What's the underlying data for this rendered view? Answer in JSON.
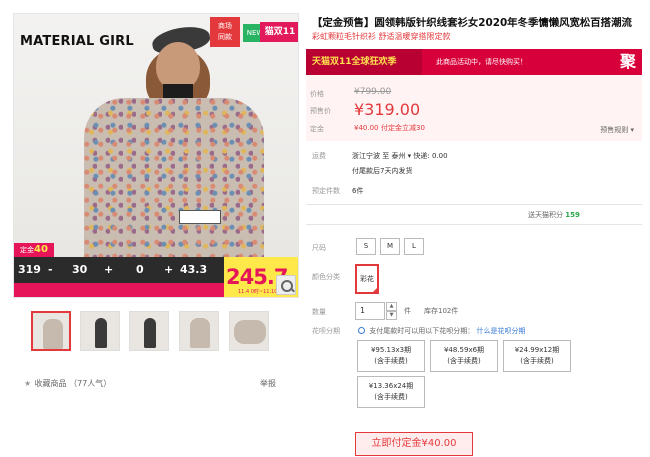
{
  "gallery": {
    "brand": "MATERIAL GIRL",
    "tag_mall": "商场\n同款",
    "tag_new": "NEW",
    "tag_double11": "猫双11",
    "banner": {
      "deposit_label": "定金",
      "deposit_value": "40",
      "price1": "319",
      "op1": "-",
      "val1": "30",
      "op2": "+",
      "val2": "0",
      "op3": "+",
      "val3": "43.3",
      "final_price": "245.7",
      "date": "11.4 0时~11.10 24"
    },
    "thumbnails": 5,
    "favorite_label": "收藏商品",
    "favorite_count": "（77人气）",
    "report_label": "举报"
  },
  "product": {
    "title": "【定金预售】圆领韩版针织线套衫女2020年冬季慵懒风宽松百搭潮流",
    "subtitle": "彩虹颗粒毛针织衫  舒适温暖穿搭限定款",
    "promo_left": "天猫双11全球狂欢季",
    "promo_text": "此商品活动中，请尽快购买！",
    "promo_gift": "聚",
    "price_label": "价格",
    "old_price": "¥799.00",
    "presale_label": "预售价",
    "presale_price": "¥319.00",
    "deposit_label": "定金",
    "deposit_value": "¥40.00",
    "deposit_note": "付定金立减30",
    "presale_rule": "预售规则",
    "shipping_label": "运费",
    "shipping_from": "浙江宁波  至 泰州",
    "shipping_fee": "快递: 0.00",
    "shipping_note": "付尾款后7天内发货",
    "sales_label": "预定件数",
    "sales_value": "6件",
    "points_label": "送天猫积分",
    "points_value": "159",
    "size_label": "尺码",
    "sizes": [
      "S",
      "M",
      "L"
    ],
    "color_label": "颜色分类",
    "color_value": "彩花",
    "qty_label": "数量",
    "qty_value": "1",
    "qty_unit": "件",
    "stock": "库存102件",
    "installment_label": "花呗分期",
    "installment_note": "支付尾款时可以用以下花呗分期：",
    "installment_link": "什么是花呗分期",
    "plans": [
      {
        "line1": "¥95.13x3期",
        "line2": "(含手续费)"
      },
      {
        "line1": "¥48.59x6期",
        "line2": "(含手续费)"
      },
      {
        "line1": "¥24.99x12期",
        "line2": "(含手续费)"
      },
      {
        "line1": "¥13.36x24期",
        "line2": "(含手续费)"
      }
    ],
    "buy_button": "立即付定金¥40.00"
  }
}
